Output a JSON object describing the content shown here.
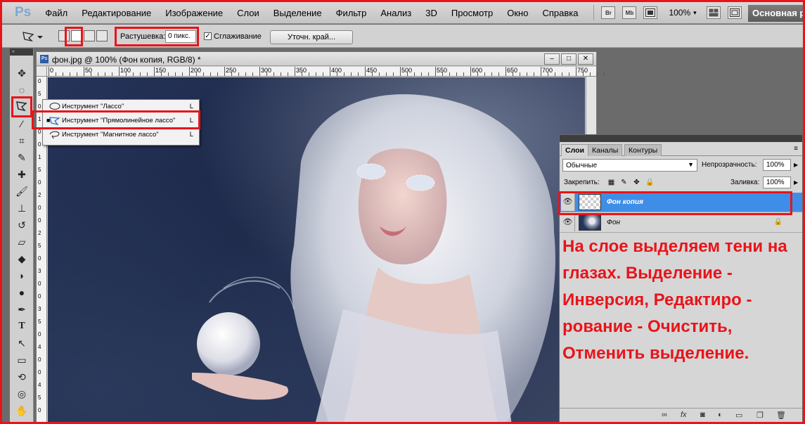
{
  "app": {
    "logo": "Ps",
    "workspace": "Основная р"
  },
  "menu": [
    "Файл",
    "Редактирование",
    "Изображение",
    "Слои",
    "Выделение",
    "Фильтр",
    "Анализ",
    "3D",
    "Просмотр",
    "Окно",
    "Справка"
  ],
  "menubar_buttons": {
    "bridge": "Br",
    "minibridge": "Mb",
    "zoom": "100%"
  },
  "options": {
    "feather_label": "Растушевка:",
    "feather_value": "0 пикс.",
    "antialias_label": "Сглаживание",
    "antialias_checked": "✓",
    "refine_edge": "Уточн. край..."
  },
  "document": {
    "title": "фон.jpg @ 100% (Фон копия, RGB/8) *",
    "ruler_h": [
      "0",
      "50",
      "100",
      "150",
      "200",
      "250",
      "300",
      "350",
      "400",
      "450",
      "500",
      "550",
      "600",
      "650",
      "700",
      "750"
    ],
    "ruler_v": [
      "0",
      "5",
      "0",
      "1",
      "0",
      "0",
      "1",
      "5",
      "0",
      "2",
      "0",
      "0",
      "2",
      "5",
      "0",
      "3",
      "0",
      "0",
      "3",
      "5",
      "0",
      "4",
      "0",
      "0",
      "4",
      "5",
      "0"
    ]
  },
  "flyout": {
    "items": [
      {
        "label": "Инструмент \"Лассо\"",
        "key": "L",
        "bullet": ""
      },
      {
        "label": "Инструмент \"Прямолинейное лассо\"",
        "key": "L",
        "bullet": "■"
      },
      {
        "label": "Инструмент \"Магнитное лассо\"",
        "key": "L",
        "bullet": ""
      }
    ]
  },
  "layers_panel": {
    "tabs": [
      "Слои",
      "Каналы",
      "Контуры"
    ],
    "blend_mode": "Обычные",
    "opacity_label": "Непрозрачность:",
    "opacity_value": "100%",
    "lock_label": "Закрепить:",
    "fill_label": "Заливка:",
    "fill_value": "100%",
    "layers": [
      {
        "name": "Фон копия",
        "selected": true
      },
      {
        "name": "Фон",
        "selected": false,
        "locked": true
      }
    ],
    "note": "На слое выделяем тени на глазах. Выделение - Инверсия, Редактиро - рование - Очистить, Отменить выделение."
  },
  "colors": {
    "highlight": "#e8141a",
    "selected_layer": "#3e8ee8",
    "note_text": "#e8141a"
  }
}
